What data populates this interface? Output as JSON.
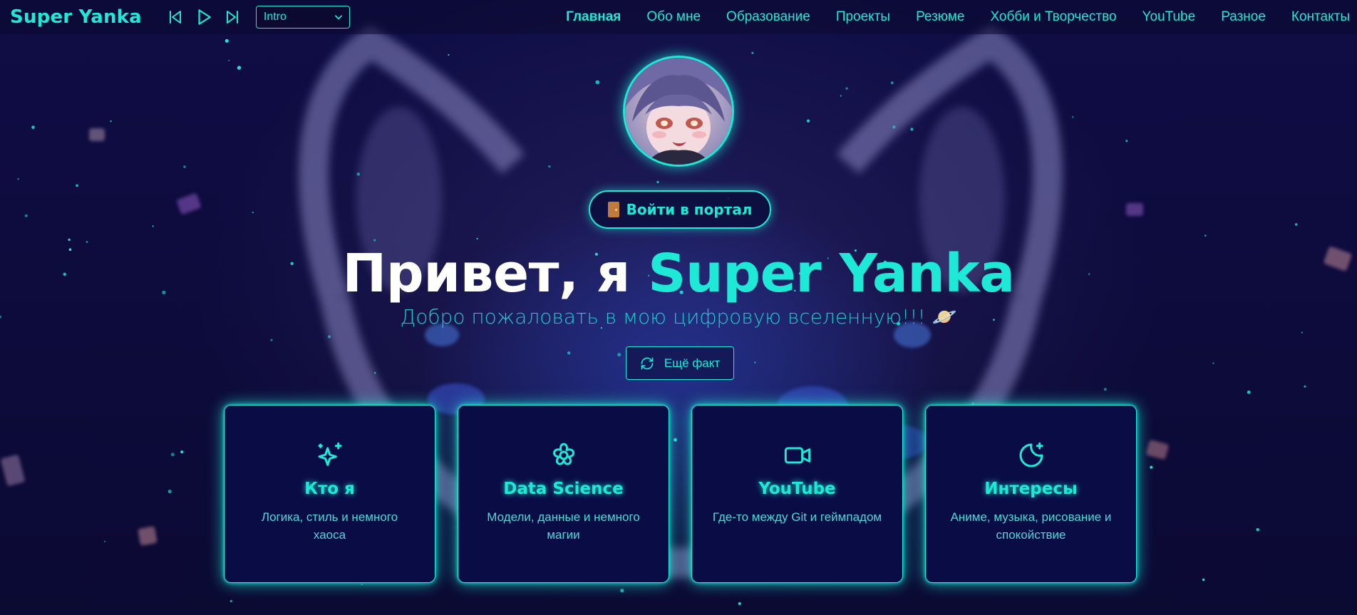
{
  "brand": "Super Yanka",
  "player": {
    "prev_icon": "skip-back-icon",
    "play_icon": "play-icon",
    "next_icon": "skip-forward-icon",
    "track": "Intro"
  },
  "nav": {
    "items": [
      {
        "label": "Главная",
        "active": true
      },
      {
        "label": "Обо мне"
      },
      {
        "label": "Образование"
      },
      {
        "label": "Проекты"
      },
      {
        "label": "Резюме"
      },
      {
        "label": "Хобби и Творчество"
      },
      {
        "label": "YouTube"
      },
      {
        "label": "Разное"
      },
      {
        "label": "Контакты"
      }
    ]
  },
  "hero": {
    "portal_button": "Войти в портал",
    "title_prefix": "Привет, я ",
    "title_accent": "Super Yanka",
    "subtitle": "Добро пожаловать в мою цифровую вселенную!!! 🪐",
    "fact_button": "Ещё факт"
  },
  "cards": [
    {
      "icon": "sparkles-icon",
      "title": "Кто я",
      "desc": "Логика, стиль и немного хаоса"
    },
    {
      "icon": "flower-icon",
      "title": "Data Science",
      "desc": "Модели, данные и немного магии"
    },
    {
      "icon": "video-icon",
      "title": "YouTube",
      "desc": "Где-то между Git и геймпадом"
    },
    {
      "icon": "moon-star-icon",
      "title": "Интересы",
      "desc": "Аниме, музыка, рисование и спокойствие"
    }
  ],
  "colors": {
    "accent": "#1de9d6",
    "background": "#0d0b3a",
    "card_bg": "#0a0c46",
    "text_white": "#ffffff"
  }
}
